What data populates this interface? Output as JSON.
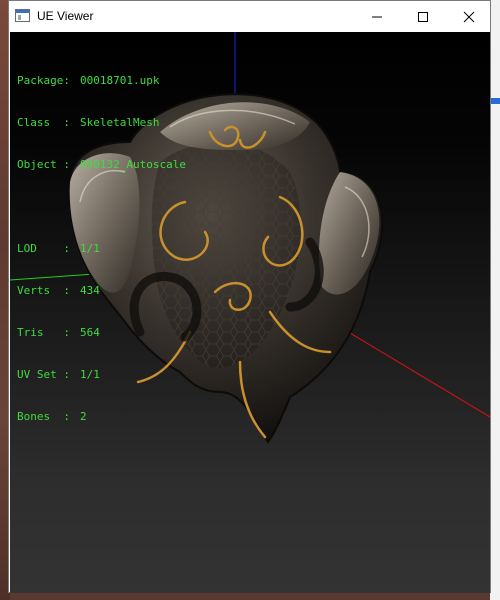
{
  "window": {
    "title": "UE Viewer"
  },
  "info": {
    "package_key": "Package:",
    "package_value": "00018701.upk",
    "class_key": "Class  :",
    "class_value": "SkeletalMesh",
    "object_key": "Object :",
    "object_value": "990132_Autoscale",
    "lod_key": "LOD    :",
    "lod_value": "1/1",
    "verts_key": "Verts  :",
    "verts_value": "434",
    "tris_key": "Tris   :",
    "tris_value": "564",
    "uvset_key": "UV Set :",
    "uvset_value": "1/1",
    "bones_key": "Bones  :",
    "bones_value": "2"
  },
  "colors": {
    "overlay_text": "#3fdc3f",
    "axis_x": "#e01010",
    "axis_y": "#20d020",
    "axis_z": "#2020e0"
  },
  "icons": {
    "minimize": "minimize-icon",
    "maximize": "maximize-icon",
    "close": "close-icon",
    "app": "app-window-icon"
  }
}
